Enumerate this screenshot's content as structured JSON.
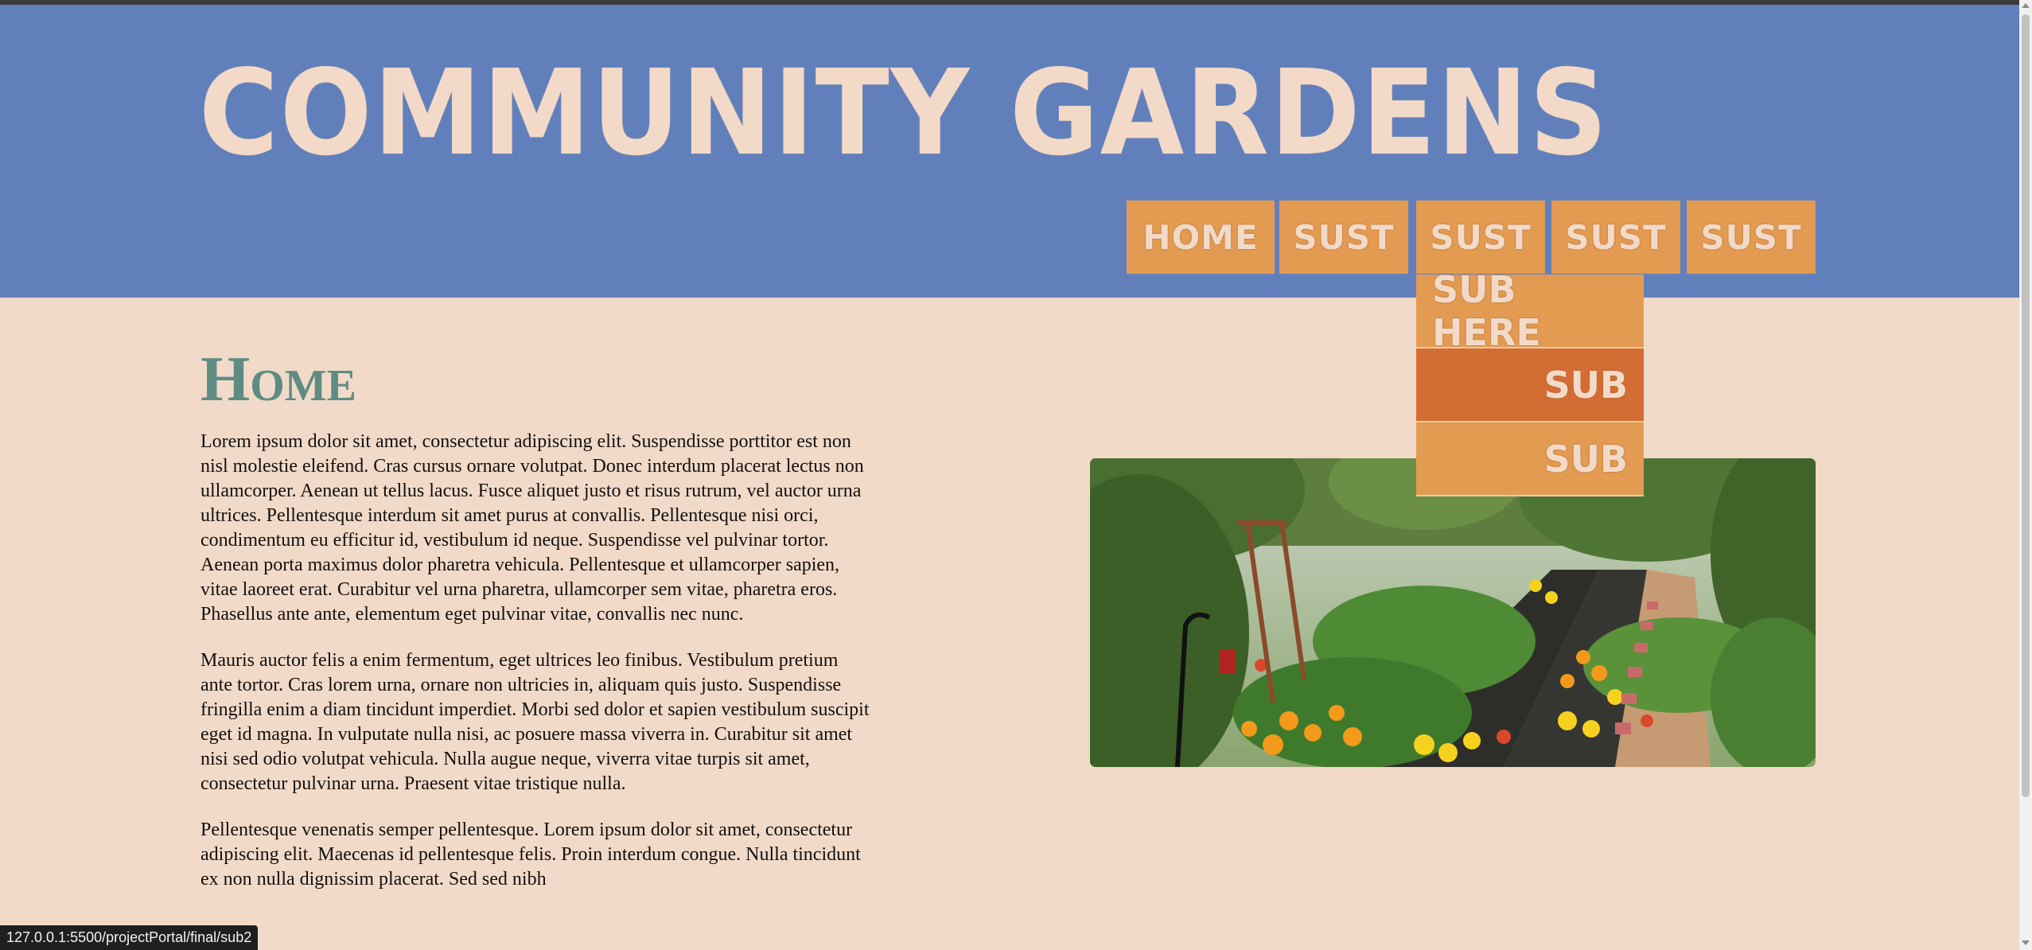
{
  "site": {
    "title": "COMMUNITY GARDENS"
  },
  "nav": {
    "items": [
      {
        "label": "HOME"
      },
      {
        "label": "SUST"
      },
      {
        "label": "SUST"
      },
      {
        "label": "SUST"
      },
      {
        "label": "SUST"
      }
    ]
  },
  "dropdown": {
    "items": [
      {
        "label": "SUB HERE"
      },
      {
        "label": "SUB"
      },
      {
        "label": "SUB"
      }
    ]
  },
  "page": {
    "heading": "Home",
    "paragraphs": [
      "Lorem ipsum dolor sit amet, consectetur adipiscing elit. Suspendisse porttitor est non nisl molestie eleifend. Cras cursus ornare volutpat. Donec interdum placerat lectus non ullamcorper. Aenean ut tellus lacus. Fusce aliquet justo et risus rutrum, vel auctor urna ultrices. Pellentesque interdum sit amet purus at convallis. Pellentesque nisi orci, condimentum eu efficitur id, vestibulum id neque. Suspendisse vel pulvinar tortor. Aenean porta maximus dolor pharetra vehicula. Pellentesque et ullamcorper sapien, vitae laoreet erat. Curabitur vel urna pharetra, ullamcorper sem vitae, pharetra eros. Phasellus ante ante, elementum eget pulvinar vitae, convallis nec nunc.",
      "Mauris auctor felis a enim fermentum, eget ultrices leo finibus. Vestibulum pretium ante tortor. Cras lorem urna, ornare non ultricies in, aliquam quis justo. Suspendisse fringilla enim a diam tincidunt imperdiet. Morbi sed dolor et sapien vestibulum suscipit eget id magna. In vulputate nulla nisi, ac posuere massa viverra in. Curabitur sit amet nisi sed odio volutpat vehicula. Nulla augue neque, viverra vitae turpis sit amet, consectetur pulvinar urna. Praesent vitae tristique nulla.",
      "Pellentesque venenatis semper pellentesque. Lorem ipsum dolor sit amet, consectetur adipiscing elit. Maecenas id pellentesque felis. Proin interdum congue. Nulla tincidunt ex non nulla dignissim placerat. Sed sed nibh"
    ]
  },
  "status": {
    "url": "127.0.0.1:5500/projectPortal/final/sub2"
  },
  "colors": {
    "header_bg": "#6180bb",
    "page_bg": "#f2dac8",
    "nav_bg": "#e39b52",
    "nav_active": "#d46d34",
    "heading": "#5e8c82"
  }
}
